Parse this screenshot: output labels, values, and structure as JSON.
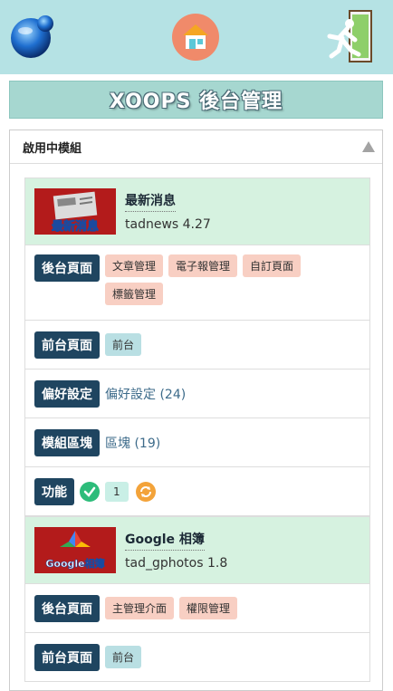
{
  "header": {
    "page_title": "XOOPS 後台管理"
  },
  "panel": {
    "title": "啟用中模組"
  },
  "modules": [
    {
      "name": "最新消息",
      "version": "tadnews 4.27",
      "thumb_text": "最新消息",
      "admin_label": "後台頁面",
      "admin_links": [
        "文章管理",
        "電子報管理",
        "自訂頁面",
        "標籤管理"
      ],
      "front_label": "前台頁面",
      "front_links": [
        "前台"
      ],
      "pref_label": "偏好設定",
      "pref_link": "偏好設定 (24)",
      "block_label": "模組區塊",
      "block_link": "區塊 (19)",
      "func_label": "功能",
      "func_count": "1"
    },
    {
      "name": "Google 相簿",
      "version": "tad_gphotos 1.8",
      "thumb_text": "Google相簿",
      "admin_label": "後台頁面",
      "admin_links": [
        "主管理介面",
        "權限管理"
      ],
      "front_label": "前台頁面",
      "front_links": [
        "前台"
      ]
    }
  ],
  "colors": {
    "topbar": "#b5e2e4",
    "module_row": "#d6f2e0",
    "label": "#1f4560",
    "tag": "#f8cfc3",
    "tag_blue": "#b9dfe3",
    "check": "#2dbc7a",
    "sync": "#f3a33a"
  }
}
